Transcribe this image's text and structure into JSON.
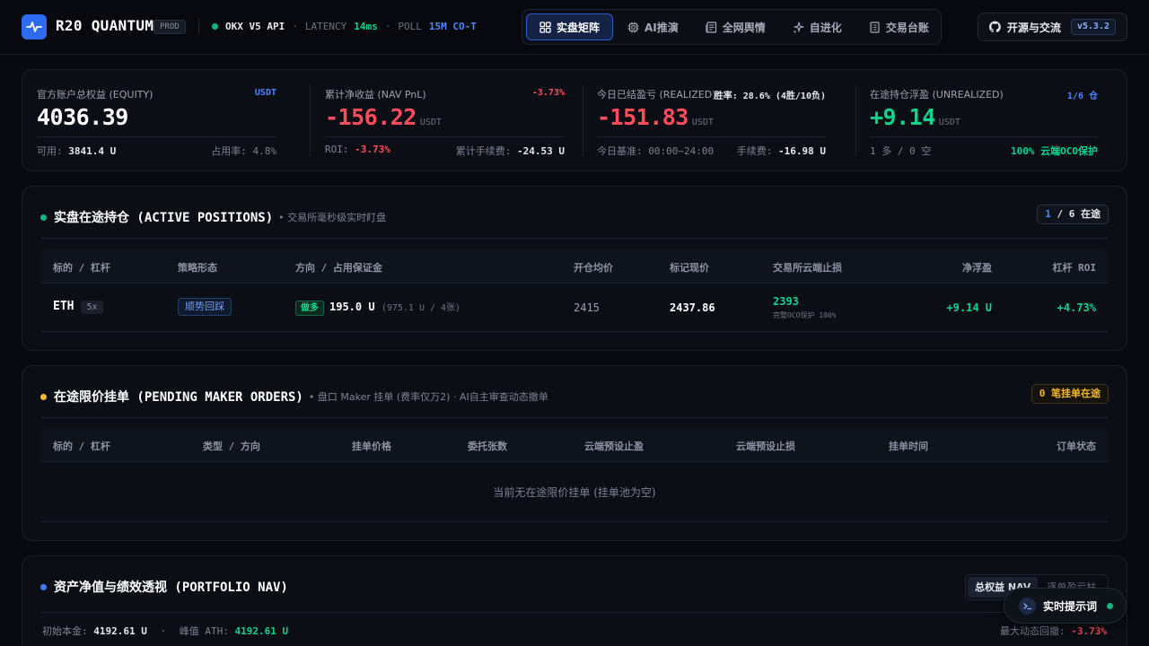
{
  "header": {
    "brand": "R20 QUANTUM",
    "env": "PROD",
    "exchange": "OKX V5 API",
    "latency_label": "LATENCY",
    "latency_value": "14ms",
    "poll_label": "POLL",
    "poll_value": "15M CO-T",
    "nav": [
      {
        "label": "实盘矩阵",
        "icon": "grid-icon",
        "active": true
      },
      {
        "label": "AI推演",
        "icon": "cpu-icon",
        "active": false
      },
      {
        "label": "全网舆情",
        "icon": "newspaper-icon",
        "active": false
      },
      {
        "label": "自进化",
        "icon": "sparkles-icon",
        "active": false
      },
      {
        "label": "交易台账",
        "icon": "ledger-icon",
        "active": false
      }
    ],
    "github_label": "开源与交流",
    "version": "v5.3.2"
  },
  "stats": {
    "equity": {
      "label": "官方账户总权益 (EQUITY)",
      "tag": "USDT",
      "value": "4036.39",
      "avail_label": "可用:",
      "avail_value": "3841.4 U",
      "usage_label": "占用率:",
      "usage_value": "4.8%"
    },
    "nav": {
      "label": "累计净收益 (NAV PnL)",
      "tag": "-3.73%",
      "value": "-156.22",
      "unit": "USDT",
      "roi_label": "ROI:",
      "roi_value": "-3.73%",
      "fee_label": "累计手续费:",
      "fee_value": "-24.53 U"
    },
    "realized": {
      "label": "今日已结盈亏 (REALIZED)",
      "tag": "胜率: 28.6% (4胜/10负)",
      "value": "-151.83",
      "unit": "USDT",
      "base_label": "今日基准:",
      "base_value": "00:00~24:00",
      "fee_label": "手续费:",
      "fee_value": "-16.98 U"
    },
    "unrealized": {
      "label": "在途持仓浮盈 (UNREALIZED)",
      "tag": "1/6 仓",
      "value": "+9.14",
      "unit": "USDT",
      "side_text": "1 多 / 0 空",
      "protect_text": "100% 云端OCO保护"
    }
  },
  "positions": {
    "title": "实盘在途持仓 (ACTIVE POSITIONS)",
    "subtitle": "• 交易所毫秒级实时盯盘",
    "badge_count": "1",
    "badge_rest": "/ 6 在途",
    "columns": [
      "标的 / 杠杆",
      "策略形态",
      "方向 / 占用保证金",
      "开仓均价",
      "标记现价",
      "交易所云端止损",
      "净浮盈",
      "杠杆 ROI"
    ],
    "rows": [
      {
        "symbol": "ETH",
        "leverage": "5x",
        "strategy": "顺势回踩",
        "side": "做多",
        "margin": "195.0 U",
        "margin_detail": "(975.1 U / 4张)",
        "entry": "2415",
        "mark": "2437.86",
        "stop": "2393",
        "stop_note": "完整OCO保护 100%",
        "pnl": "+9.14 U",
        "roi": "+4.73%"
      }
    ]
  },
  "orders": {
    "title": "在途限价挂单 (PENDING MAKER ORDERS)",
    "subtitle": "• 盘口 Maker 挂单 (费率仅万2) · AI自主审查动态撤单",
    "badge": "0 笔挂单在途",
    "columns": [
      "标的 / 杠杆",
      "类型 / 方向",
      "挂单价格",
      "委托张数",
      "云端预设止盈",
      "云端预设止损",
      "挂单时间",
      "订单状态"
    ],
    "empty_text": "当前无在途限价挂单 (挂单池为空)"
  },
  "portfolio": {
    "title": "资产净值与绩效透视 (PORTFOLIO NAV)",
    "tabs": [
      "总权益 NAV",
      "逐单盈亏柱"
    ],
    "initial_label": "初始本金:",
    "initial_value": "4192.61 U",
    "ath_label": "峰值 ATH:",
    "ath_value": "4192.61 U",
    "drawdown_label": "最大动态回撤:",
    "drawdown_value": "-3.73%"
  },
  "floating": {
    "label": "实时提示词"
  }
}
